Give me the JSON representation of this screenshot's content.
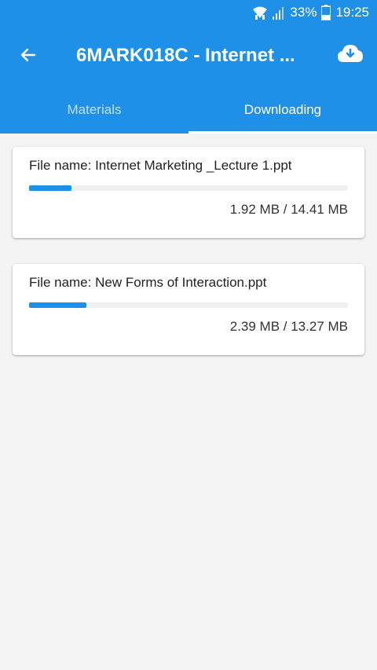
{
  "status_bar": {
    "battery_percent": "33%",
    "time": "19:25",
    "icons": [
      "wifi-icon",
      "signal-icon",
      "battery-icon"
    ]
  },
  "toolbar": {
    "back_icon": "back-arrow-icon",
    "title": "6MARK018C - Internet ...",
    "action_icon": "cloud-download-icon"
  },
  "tabs": [
    {
      "label": "Materials",
      "active": false
    },
    {
      "label": "Downloading",
      "active": true
    }
  ],
  "downloads": [
    {
      "file_name": "File name: Internet Marketing _Lecture 1.ppt",
      "size_text": "1.92 MB / 14.41 MB",
      "progress": 0.133
    },
    {
      "file_name": "File name: New Forms of Interaction.ppt",
      "size_text": "2.39 MB / 13.27 MB",
      "progress": 0.18
    }
  ],
  "colors": {
    "primary": "#1e90e8",
    "background": "#f4f4f4",
    "card": "#ffffff"
  }
}
